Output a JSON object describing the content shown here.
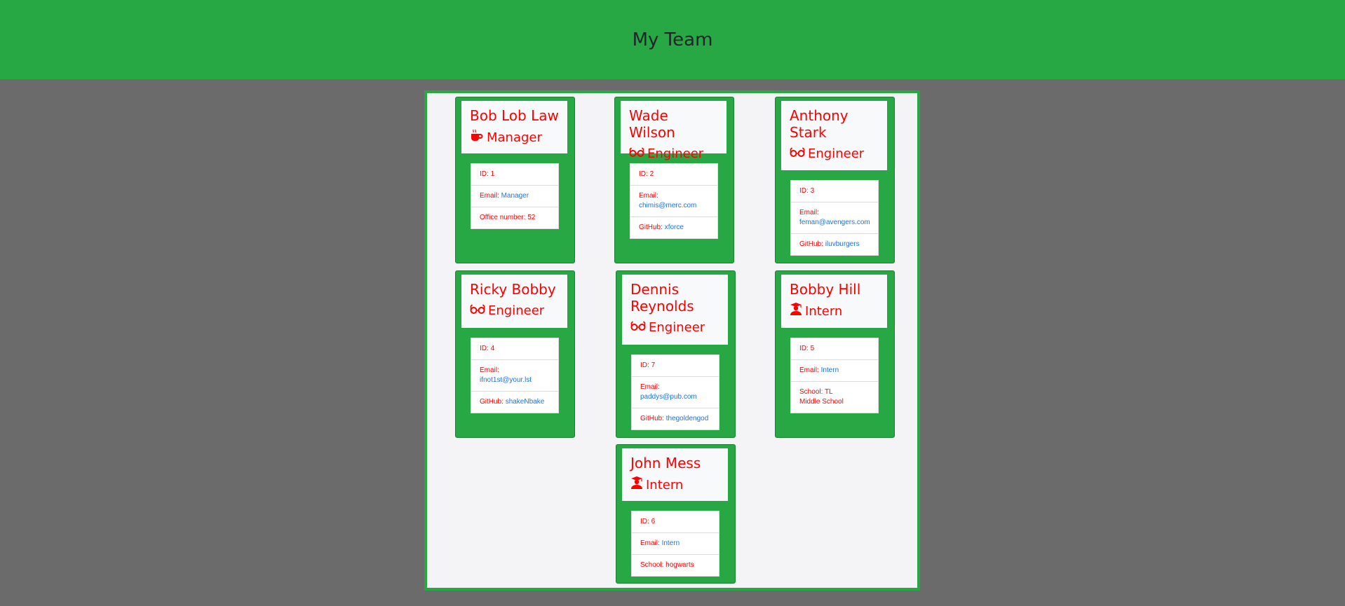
{
  "header": {
    "title": "My Team"
  },
  "labels": {
    "id": "ID: ",
    "email": "Email: ",
    "office": "Office number: ",
    "github": "GitHub: ",
    "school": "School: "
  },
  "members": [
    {
      "name": "Bob Lob Law",
      "role": "Manager",
      "role_icon": "coffee-icon",
      "id": "1",
      "email": "Manager",
      "extra_label": "office",
      "extra_value": "52"
    },
    {
      "name": "Wade Wilson",
      "role": "Engineer",
      "role_icon": "glasses-icon",
      "id": "2",
      "email": "chimis@merc.com",
      "extra_label": "github",
      "extra_value": "xforce"
    },
    {
      "name": "Anthony Stark",
      "role": "Engineer",
      "role_icon": "glasses-icon",
      "id": "3",
      "email": "feman@avengers.com",
      "extra_label": "github",
      "extra_value": "iluvburgers"
    },
    {
      "name": "Ricky Bobby",
      "role": "Engineer",
      "role_icon": "glasses-icon",
      "id": "4",
      "email": "ifnot1st@your.lst",
      "extra_label": "github",
      "extra_value": "shakeNbake"
    },
    {
      "name": "Dennis Reynolds",
      "role": "Engineer",
      "role_icon": "glasses-icon",
      "id": "7",
      "email": "paddys@pub.com",
      "extra_label": "github",
      "extra_value": "thegoldengod"
    },
    {
      "name": "Bobby Hill",
      "role": "Intern",
      "role_icon": "graduate-icon",
      "id": "5",
      "email": "Intern",
      "extra_label": "school",
      "extra_value": "TL Middle School"
    },
    {
      "name": "John Mess",
      "role": "Intern",
      "role_icon": "graduate-icon",
      "id": "6",
      "email": "Intern",
      "extra_label": "school",
      "extra_value": "hogwarts"
    }
  ],
  "colors": {
    "accent": "#28a745",
    "text": "#ff0000",
    "link": "#1a73e8",
    "background": "#6b6b6b"
  }
}
